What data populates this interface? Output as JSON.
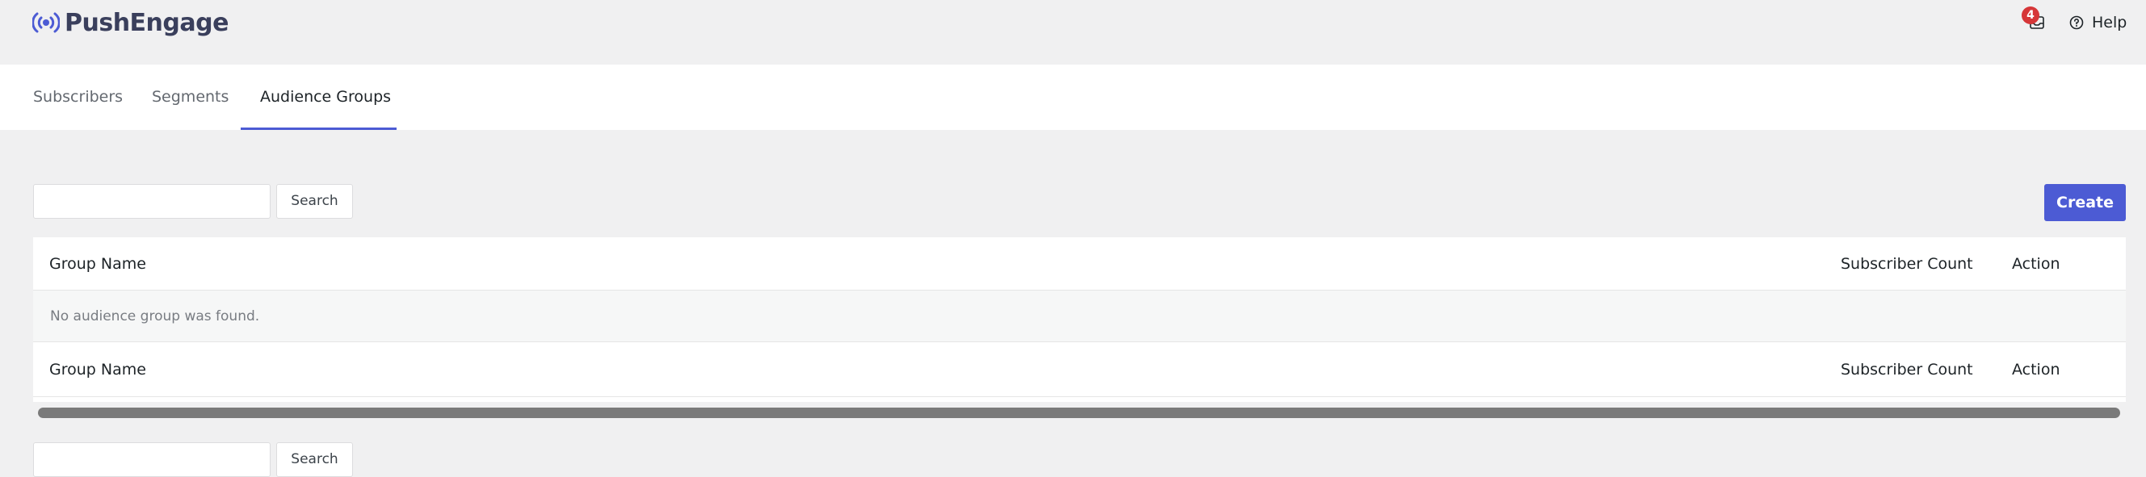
{
  "app": {
    "logo_text": "PushEngage",
    "brand_color": "#4c5bd4"
  },
  "header": {
    "notification_count": "4",
    "notification_icon": "inbox-icon",
    "help_label": "Help",
    "help_icon": "help-circle-icon"
  },
  "tabs": [
    {
      "label": "Subscribers",
      "active": false
    },
    {
      "label": "Segments",
      "active": false
    },
    {
      "label": "Audience Groups",
      "active": true
    }
  ],
  "toolbar": {
    "search_value": "",
    "search_label": "Search",
    "create_label": "Create"
  },
  "table": {
    "columns": [
      "Group Name",
      "Subscriber Count",
      "Action"
    ],
    "empty_message": "No audience group was found.",
    "footer_columns": [
      "Group Name",
      "Subscriber Count",
      "Action"
    ]
  },
  "bottom_toolbar": {
    "search_label": "Search"
  }
}
